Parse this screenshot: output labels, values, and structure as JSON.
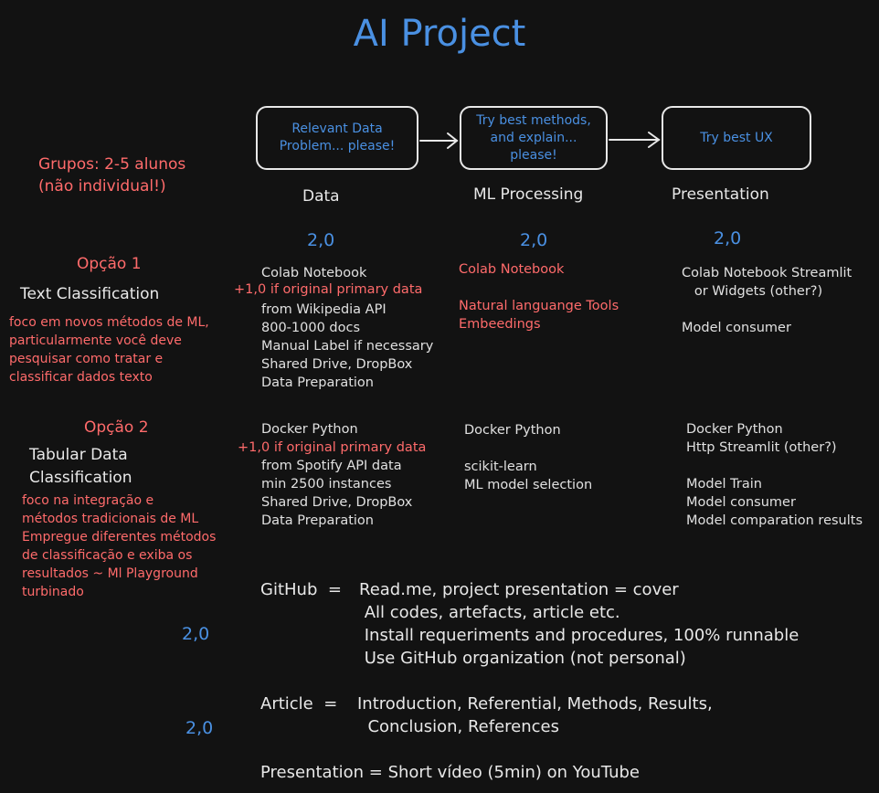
{
  "title": "AI Project",
  "boxes": {
    "data": "Relevant Data\nProblem... please!",
    "ml": "Try best methods,\nand explain...\nplease!",
    "presentation": "Try best UX"
  },
  "stages": {
    "data": "Data",
    "ml": "ML Processing",
    "presentation": "Presentation"
  },
  "scores": {
    "data": "2,0",
    "ml": "2,0",
    "presentation": "2,0",
    "github": "2,0",
    "article": "2,0"
  },
  "groups": "Grupos: 2-5 alunos\n(não individual!)",
  "option1": {
    "label": "Opção 1",
    "name": "Text Classification",
    "note": "foco em novos métodos de ML,\nparticularmente você deve\npesquisar como tratar e\nclassificar dados texto",
    "data_line1": "Colab Notebook",
    "data_bonus": "+1,0 if original primary data",
    "data_rest": "from Wikipedia API\n800-1000 docs\nManual Label if necessary\nShared Drive, DropBox\nData Preparation",
    "ml": "Colab Notebook\n\nNatural languange Tools\nEmbeedings",
    "presentation": "Colab Notebook Streamlit\n   or Widgets (other?)\n\nModel consumer"
  },
  "option2": {
    "label": "Opção 2",
    "name": "Tabular Data\nClassification",
    "note": "foco na integração e\nmétodos tradicionais de ML\nEmpregue diferentes métodos\nde classificação e exiba os\nresultados ~ Ml Playground\nturbinado",
    "data_line1": "Docker Python",
    "data_bonus": "+1,0 if original primary data",
    "data_rest": "from Spotify API data\nmin 2500 instances\nShared Drive, DropBox\nData Preparation",
    "ml": "Docker Python\n\nscikit-learn\nML model selection",
    "presentation": "Docker Python\nHttp Streamlit (other?)\n\nModel Train\nModel consumer\nModel comparation results"
  },
  "github": {
    "label": "GitHub  =  ",
    "lines": "Read.me, project presentation = cover\n All codes, artefacts, article etc.\n Install requeriments and procedures, 100% runnable\n Use GitHub organization (not personal)"
  },
  "article": {
    "label": "Article  =  ",
    "lines": "Introduction, Referential, Methods, Results,\n  Conclusion, References"
  },
  "presentation_line": "Presentation = Short vídeo (5min) on YouTube"
}
